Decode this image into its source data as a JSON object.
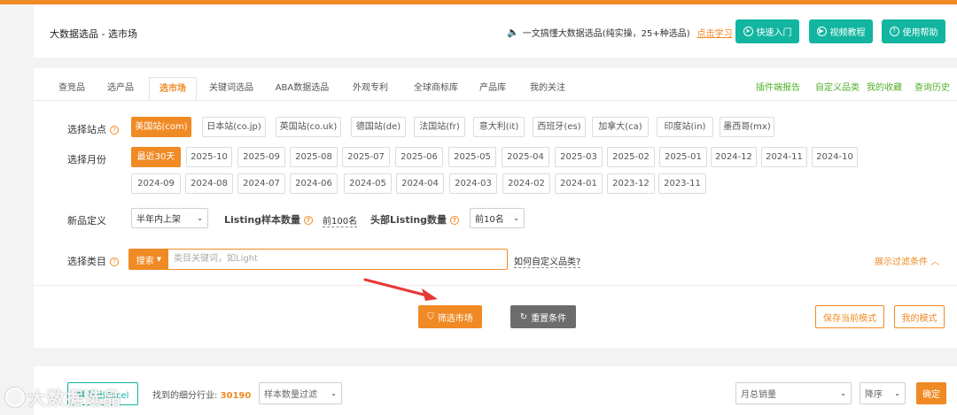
{
  "header": {
    "app_title": "大数据选品 - 选市场",
    "notice_text": "一文搞懂大数据选品(纯实操，25+种选品)",
    "notice_link": "点击学习",
    "buttons": [
      "快速入门",
      "视频教程",
      "使用帮助"
    ]
  },
  "tabs": {
    "items": [
      "查竞品",
      "选产品",
      "选市场",
      "关键词选品",
      "ABA数据选品",
      "外观专利",
      "全球商标库",
      "产品库",
      "我的关注"
    ],
    "active_index": 2,
    "right_links": [
      "插件端报告",
      "自定义品类",
      "我的收藏",
      "查询历史"
    ]
  },
  "filters": {
    "site_label": "选择站点",
    "sites": [
      "美国站(com)",
      "日本站(co.jp)",
      "英国站(co.uk)",
      "德国站(de)",
      "法国站(fr)",
      "意大利(it)",
      "西班牙(es)",
      "加拿大(ca)",
      "印度站(in)",
      "墨西哥(mx)"
    ],
    "month_label": "选择月份",
    "months_row1": [
      "最近30天",
      "2025-10",
      "2025-09",
      "2025-08",
      "2025-07",
      "2025-06",
      "2025-05",
      "2025-04",
      "2025-03",
      "2025-02",
      "2025-01",
      "2024-12",
      "2024-11",
      "2024-10"
    ],
    "months_row2": [
      "2024-09",
      "2024-08",
      "2024-07",
      "2024-06",
      "2024-05",
      "2024-04",
      "2024-03",
      "2024-02",
      "2024-01",
      "2023-12",
      "2023-11"
    ],
    "new_def_label": "新品定义",
    "new_def_value": "半年内上架",
    "listing_sample_label": "Listing样本数量",
    "listing_sample_value": "前100名",
    "top_listing_label": "头部Listing数量",
    "top_listing_value": "前10名",
    "category_label": "选择类目",
    "search_button": "搜索",
    "search_placeholder": "类目关键词，如Light",
    "custom_category_link": "如何自定义品类?",
    "expand_filters": "展示过滤条件"
  },
  "actions": {
    "filter_market": "筛选市场",
    "reset": "重置条件",
    "save_mode": "保存当前模式",
    "my_mode": "我的模式"
  },
  "bottom": {
    "excel_label": "导出Excel",
    "found_label": "找到的细分行业:",
    "found_count": "30190",
    "sample_filter": "样本数量过滤",
    "sort_field": "月总销量",
    "sort_order": "降序",
    "confirm": "确定"
  },
  "watermark": "大数据选品",
  "colors": {
    "accent": "#f08a24",
    "teal": "#12b5a0",
    "green_link": "#52b02c",
    "arrow": "#e53935"
  }
}
